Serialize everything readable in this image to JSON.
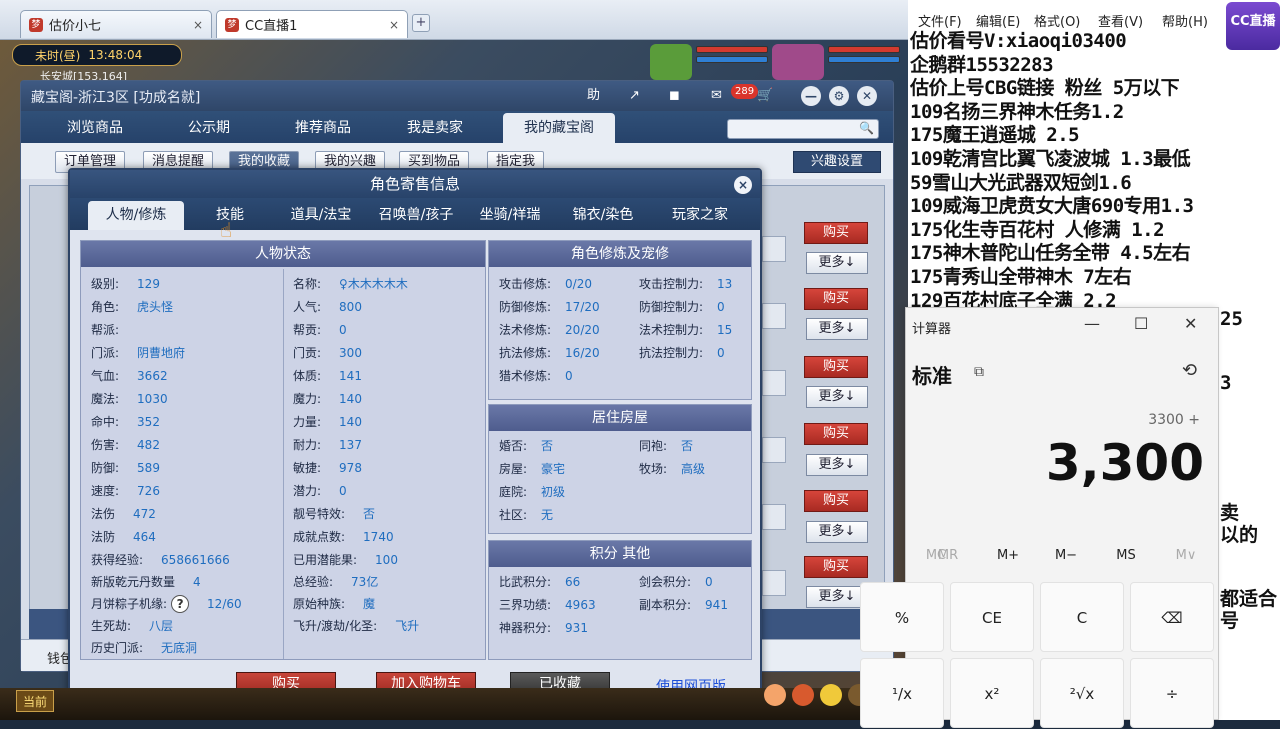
{
  "browser": {
    "tabs": [
      {
        "label": "估价小七",
        "close": "×"
      },
      {
        "label": "CC直播1",
        "close": "×"
      }
    ],
    "new_tab": "+"
  },
  "game": {
    "clock_period": "未时(昼)",
    "clock_time": "13:48:04",
    "location": "长安城[153,164]",
    "current_label": "当前"
  },
  "cbg": {
    "title": "藏宝阁-浙江3区 [功成名就]",
    "help_label": "助",
    "message_count": "289",
    "nav_tabs": [
      "浏览商品",
      "公示期",
      "推荐商品",
      "我是卖家",
      "我的藏宝阁"
    ],
    "sub_tabs": [
      "订单管理",
      "消息提醒",
      "我的收藏",
      "我的兴趣",
      "买到物品",
      "指定我"
    ],
    "interest_settings": "兴趣设置",
    "buy_label": "购买",
    "more_label": "更多↓",
    "bottom_label": "钱包"
  },
  "modal": {
    "title": "角色寄售信息",
    "close": "×",
    "tabs": [
      "人物/修炼",
      "技能",
      "道具/法宝",
      "召唤兽/孩子",
      "坐骑/祥瑞",
      "锦衣/染色",
      "玩家之家"
    ],
    "status_header": "人物状态",
    "left_col1": [
      {
        "k": "级别:",
        "v": "129"
      },
      {
        "k": "角色:",
        "v": "虎头怪"
      },
      {
        "k": "帮派:",
        "v": ""
      },
      {
        "k": "门派:",
        "v": "阴曹地府"
      },
      {
        "k": "气血:",
        "v": "3662"
      },
      {
        "k": "魔法:",
        "v": "1030"
      },
      {
        "k": "命中:",
        "v": "352"
      },
      {
        "k": "伤害:",
        "v": "482"
      },
      {
        "k": "防御:",
        "v": "589"
      },
      {
        "k": "速度:",
        "v": "726"
      },
      {
        "k": "法伤",
        "v": "472"
      },
      {
        "k": "法防",
        "v": "464"
      }
    ],
    "left_col2": [
      {
        "k": "名称:",
        "v": "♀木木木木木"
      },
      {
        "k": "人气:",
        "v": "800"
      },
      {
        "k": "帮贡:",
        "v": "0"
      },
      {
        "k": "门贡:",
        "v": "300"
      },
      {
        "k": "体质:",
        "v": "141"
      },
      {
        "k": "魔力:",
        "v": "140"
      },
      {
        "k": "力量:",
        "v": "140"
      },
      {
        "k": "耐力:",
        "v": "137"
      },
      {
        "k": "敏捷:",
        "v": "978"
      },
      {
        "k": "潜力:",
        "v": "0"
      },
      {
        "k": "靓号特效:",
        "v": "否"
      },
      {
        "k": "成就点数:",
        "v": "1740"
      }
    ],
    "wide_rows": [
      {
        "k": "获得经验:",
        "v": "658661666",
        "k2": "已用潜能果:",
        "v2": "100"
      },
      {
        "k": "新版乾元丹数量",
        "v": "4",
        "k2": "总经验:",
        "v2": "73亿"
      },
      {
        "k": "月饼粽子机缘:",
        "v": "12/60",
        "k2": "原始种族:",
        "v2": "魔"
      },
      {
        "k": "生死劫:",
        "v": "八层",
        "k2": "飞升/渡劫/化圣:",
        "v2": "飞升"
      },
      {
        "k": "历史门派:",
        "v": "无底洞",
        "k2": "",
        "v2": ""
      }
    ],
    "qmark": "?",
    "cultivation_header": "角色修炼及宠修",
    "cultivation": [
      {
        "k": "攻击修炼:",
        "v": "0/20",
        "k2": "攻击控制力:",
        "v2": "13"
      },
      {
        "k": "防御修炼:",
        "v": "17/20",
        "k2": "防御控制力:",
        "v2": "0"
      },
      {
        "k": "法术修炼:",
        "v": "20/20",
        "k2": "法术控制力:",
        "v2": "15"
      },
      {
        "k": "抗法修炼:",
        "v": "16/20",
        "k2": "抗法控制力:",
        "v2": "0"
      },
      {
        "k": "猎术修炼:",
        "v": "0",
        "k2": "",
        "v2": ""
      }
    ],
    "house_header": "居住房屋",
    "house": [
      {
        "k": "婚否:",
        "v": "否",
        "k2": "同袍:",
        "v2": "否"
      },
      {
        "k": "房屋:",
        "v": "豪宅",
        "k2": "牧场:",
        "v2": "高级"
      },
      {
        "k": "庭院:",
        "v": "初级",
        "k2": "",
        "v2": ""
      },
      {
        "k": "社区:",
        "v": "无",
        "k2": "",
        "v2": ""
      }
    ],
    "points_header": "积分 其他",
    "points": [
      {
        "k": "比武积分:",
        "v": "66",
        "k2": "剑会积分:",
        "v2": "0"
      },
      {
        "k": "三界功绩:",
        "v": "4963",
        "k2": "副本积分:",
        "v2": "941"
      },
      {
        "k": "神器积分:",
        "v": "931",
        "k2": "",
        "v2": ""
      }
    ],
    "buttons": {
      "buy": "购买",
      "add_cart": "加入购物车",
      "favorited": "已收藏",
      "web": "使用网页版"
    }
  },
  "notepad": {
    "menu": [
      "文件(F)",
      "编辑(E)",
      "格式(O)",
      "查看(V)",
      "帮助(H)"
    ],
    "lines": [
      "估价看号V:xiaoqi03400",
      "企鹅群15532283",
      "估价上号CBG链接 粉丝 5万以下",
      "109名扬三界神木任务1.2",
      "175魔王逍遥城 2.5",
      "109乾清宫比翼飞凌波城 1.3最低",
      "59雪山大光武器双短剑1.6",
      "109威海卫虎贲女大唐690专用1.3",
      "175化生寺百花村 人修满 1.2",
      "175神木普陀山任务全带 4.5左右",
      "175青秀山全带神木  7左右",
      "129百花村底子全满 2.2",
      "175凌波城花好月圆全带4.9"
    ],
    "peeks": [
      "25",
      "3",
      "卖",
      "以的",
      "都适合",
      "号"
    ],
    "logo": "CC直播"
  },
  "calculator": {
    "title": "计算器",
    "mode": "标准",
    "expression": "3300 +",
    "display": "3,300",
    "memory": [
      "MC",
      "MR",
      "M+",
      "M−",
      "MS",
      "M∨"
    ],
    "keys_row1": [
      "%",
      "CE",
      "C",
      "⌫"
    ],
    "keys_row2": [
      "¹/x",
      "x²",
      "²√x",
      "÷"
    ],
    "window_controls": [
      "—",
      "☐",
      "✕"
    ]
  }
}
